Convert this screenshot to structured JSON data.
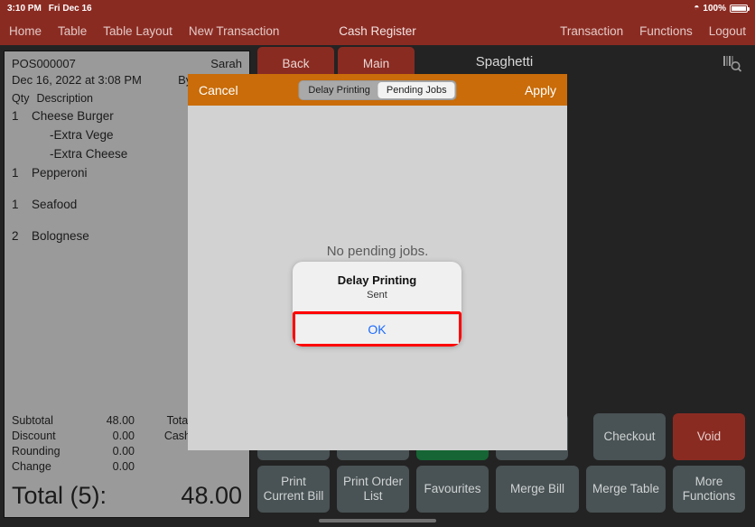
{
  "status_bar": {
    "time": "3:10 PM",
    "date": "Fri Dec 16",
    "wifi_icon": "wifi-icon",
    "battery_percent": "100%",
    "battery_icon": "battery-full-icon"
  },
  "nav": {
    "title": "Cash Register",
    "left_items": [
      {
        "label": "Home",
        "name": "nav-home"
      },
      {
        "label": "Table",
        "name": "nav-table"
      },
      {
        "label": "Table Layout",
        "name": "nav-table-layout"
      },
      {
        "label": "New Transaction",
        "name": "nav-new-transaction"
      }
    ],
    "right_items": [
      {
        "label": "Transaction",
        "name": "nav-transaction"
      },
      {
        "label": "Functions",
        "name": "nav-functions"
      },
      {
        "label": "Logout",
        "name": "nav-logout"
      }
    ]
  },
  "receipt": {
    "order_no": "POS000007",
    "datetime": "Dec 16, 2022 at 3:08 PM",
    "customer": "Sarah",
    "by_label": "By Admin",
    "col_qty": "Qty",
    "col_desc": "Description",
    "items": [
      {
        "qty": "1",
        "desc": "Cheese Burger",
        "modifier": false,
        "gap": false
      },
      {
        "qty": "",
        "desc": "-Extra Vege",
        "modifier": true,
        "gap": false
      },
      {
        "qty": "",
        "desc": "-Extra Cheese",
        "modifier": true,
        "gap": false
      },
      {
        "qty": "1",
        "desc": "Pepperoni",
        "modifier": false,
        "gap": false
      },
      {
        "qty": "1",
        "desc": "Seafood",
        "modifier": false,
        "gap": true
      },
      {
        "qty": "2",
        "desc": "Bolognese",
        "modifier": false,
        "gap": true
      }
    ],
    "totals": [
      {
        "label": "Subtotal",
        "value": "48.00",
        "label2": "Total"
      },
      {
        "label": "Discount",
        "value": "0.00",
        "label2": "Cash"
      },
      {
        "label": "Rounding",
        "value": "0.00",
        "label2": ""
      },
      {
        "label": "Change",
        "value": "0.00",
        "label2": ""
      }
    ],
    "grand_label": "Total (5):",
    "grand_value": "48.00"
  },
  "content": {
    "back_label": "Back",
    "main_label": "Main",
    "title": "Spaghetti",
    "barcode_icon": "barcode-search-icon"
  },
  "buttons": {
    "row_top": [
      {
        "label": "",
        "style": "dark",
        "name": "hidden-button-1"
      },
      {
        "label": "",
        "style": "dark",
        "name": "hidden-button-2"
      },
      {
        "label": "",
        "style": "green",
        "name": "hidden-green-button"
      },
      {
        "label": "",
        "style": "dark",
        "name": "hidden-button-3"
      },
      {
        "label": "Checkout",
        "style": "dark",
        "name": "checkout-button"
      },
      {
        "label": "Void",
        "style": "void",
        "name": "void-button"
      }
    ],
    "row_bottom": [
      {
        "label": "Print Current Bill",
        "style": "dark",
        "name": "print-current-bill-button"
      },
      {
        "label": "Print Order List",
        "style": "dark",
        "name": "print-order-list-button"
      },
      {
        "label": "Favourites",
        "style": "dark",
        "name": "favourites-button"
      },
      {
        "label": "Merge Bill",
        "style": "dark",
        "name": "merge-bill-button"
      },
      {
        "label": "Merge Table",
        "style": "dark",
        "name": "merge-table-button"
      },
      {
        "label": "More Functions",
        "style": "dark",
        "name": "more-functions-button"
      }
    ]
  },
  "modal": {
    "cancel_label": "Cancel",
    "apply_label": "Apply",
    "segments": [
      {
        "label": "Delay Printing",
        "selected": false
      },
      {
        "label": "Pending Jobs",
        "selected": true
      }
    ],
    "empty_message": "No pending jobs."
  },
  "alert": {
    "title": "Delay Printing",
    "message": "Sent",
    "ok_label": "OK",
    "highlight_color": "#ff0000",
    "ok_text_color": "#1a6aff"
  },
  "colors": {
    "header_red": "#8a2b22",
    "modal_orange": "#c96c09",
    "button_slate": "#495254",
    "green": "#166534",
    "receipt_gray": "#9a9a9a"
  }
}
